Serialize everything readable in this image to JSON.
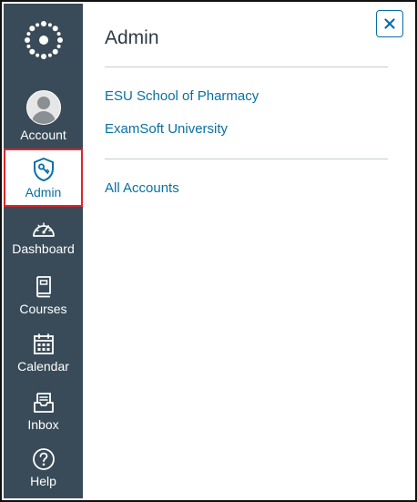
{
  "nav": {
    "logo_icon": "canvas-logo-icon",
    "items": [
      {
        "label": "Account",
        "icon": "user-avatar-icon"
      },
      {
        "label": "Admin",
        "icon": "admin-shield-icon"
      },
      {
        "label": "Dashboard",
        "icon": "dashboard-gauge-icon"
      },
      {
        "label": "Courses",
        "icon": "courses-book-icon"
      },
      {
        "label": "Calendar",
        "icon": "calendar-icon"
      },
      {
        "label": "Inbox",
        "icon": "inbox-icon"
      },
      {
        "label": "Help",
        "icon": "help-question-icon"
      }
    ]
  },
  "tray": {
    "title": "Admin",
    "close_icon": "close-icon",
    "accounts": [
      {
        "label": "ESU School of Pharmacy"
      },
      {
        "label": "ExamSoft University"
      }
    ],
    "all_accounts_label": "All Accounts"
  },
  "colors": {
    "sidebar_bg": "#394b58",
    "link": "#0770a3",
    "highlight_border": "#d9262b",
    "title_text": "#2d3b45"
  }
}
